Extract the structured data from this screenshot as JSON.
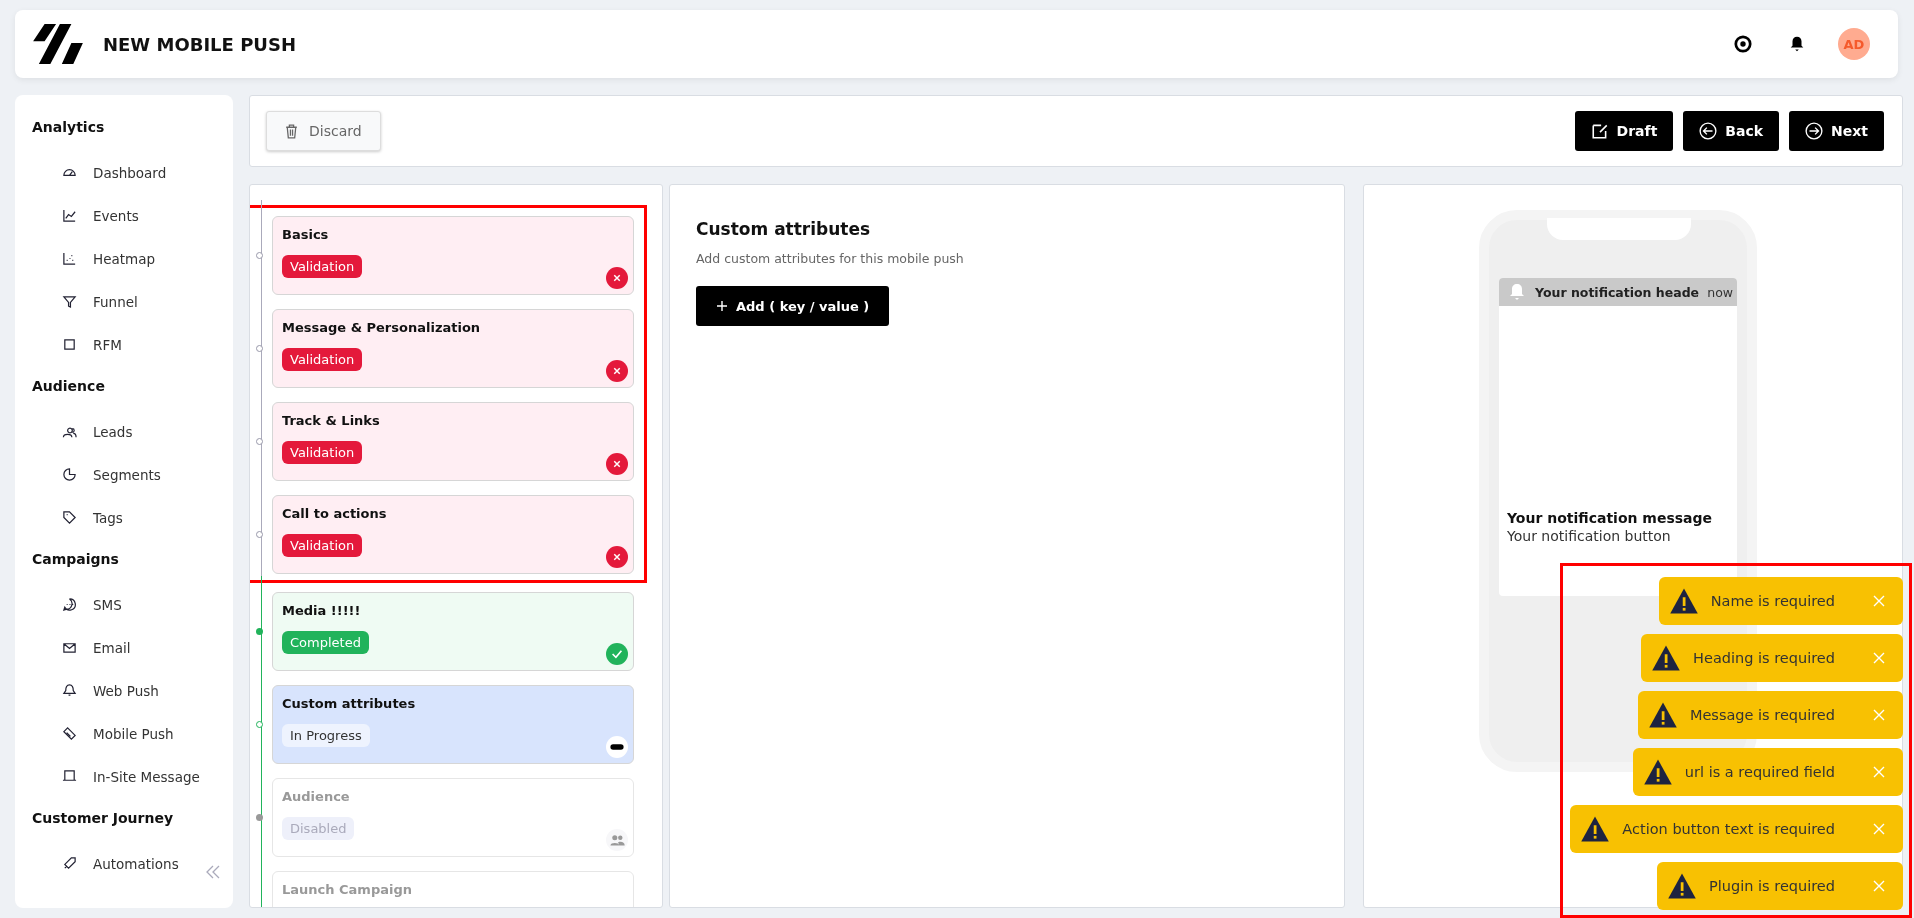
{
  "header": {
    "title": "NEW MOBILE PUSH",
    "avatar": "AD"
  },
  "sidebar": {
    "sections": [
      {
        "heading": "Analytics",
        "items": [
          "Dashboard",
          "Events",
          "Heatmap",
          "Funnel",
          "RFM"
        ]
      },
      {
        "heading": "Audience",
        "items": [
          "Leads",
          "Segments",
          "Tags"
        ]
      },
      {
        "heading": "Campaigns",
        "items": [
          "SMS",
          "Email",
          "Web Push",
          "Mobile Push",
          "In-Site Message"
        ]
      },
      {
        "heading": "Customer Journey",
        "items": [
          "Automations"
        ]
      }
    ]
  },
  "toolbar": {
    "discard": "Discard",
    "draft": "Draft",
    "back": "Back",
    "next": "Next"
  },
  "steps": [
    {
      "title": "Basics",
      "status": "Validation",
      "kind": "validation",
      "flagged": true
    },
    {
      "title": "Message & Personalization",
      "status": "Validation",
      "kind": "validation",
      "flagged": true
    },
    {
      "title": "Track & Links",
      "status": "Validation",
      "kind": "validation",
      "flagged": true
    },
    {
      "title": "Call to actions",
      "status": "Validation",
      "kind": "validation",
      "flagged": true
    },
    {
      "title": "Media !!!!!",
      "status": "Completed",
      "kind": "completed",
      "flagged": false
    },
    {
      "title": "Custom attributes",
      "status": "In Progress",
      "kind": "progress",
      "flagged": false
    },
    {
      "title": "Audience",
      "status": "Disabled",
      "kind": "disabled",
      "flagged": false
    },
    {
      "title": "Launch Campaign",
      "kind": "disabled",
      "flagged": false
    }
  ],
  "editor": {
    "title": "Custom attributes",
    "subtitle": "Add custom attributes for this mobile push",
    "add_button": "Add ( key / value )"
  },
  "preview": {
    "header": "Your notification heade",
    "time": "now",
    "message": "Your notification message",
    "button": "Your notification button"
  },
  "toasts_flagged": true,
  "toasts": [
    "Name is required",
    "Heading is required",
    "Message is required",
    "url is a required field",
    "Action button text is required",
    "Plugin is required"
  ]
}
